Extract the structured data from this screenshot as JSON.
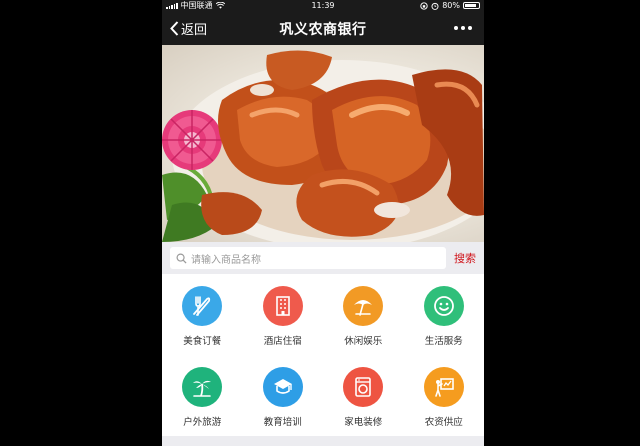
{
  "status_bar": {
    "carrier": "中国联通",
    "time": "11:39",
    "battery": "80%"
  },
  "nav": {
    "back_label": "返回",
    "title": "巩义农商银行"
  },
  "banner": {
    "slides": 2,
    "active_slide": 1
  },
  "search": {
    "placeholder": "请输入商品名称",
    "button": "搜索"
  },
  "categories": [
    {
      "label": "美食订餐",
      "icon": "utensils-icon",
      "color": "#3aa8e8"
    },
    {
      "label": "酒店住宿",
      "icon": "hotel-icon",
      "color": "#ef5a4c"
    },
    {
      "label": "休闲娱乐",
      "icon": "umbrella-icon",
      "color": "#f29a25"
    },
    {
      "label": "生活服务",
      "icon": "smiley-icon",
      "color": "#2fbf7a"
    },
    {
      "label": "户外旅游",
      "icon": "palm-tree-icon",
      "color": "#1fb37c"
    },
    {
      "label": "教育培训",
      "icon": "education-icon",
      "color": "#2e9ee6"
    },
    {
      "label": "家电装修",
      "icon": "washing-machine-icon",
      "color": "#ee5442"
    },
    {
      "label": "农资供应",
      "icon": "farm-supply-icon",
      "color": "#f59c1f"
    }
  ]
}
